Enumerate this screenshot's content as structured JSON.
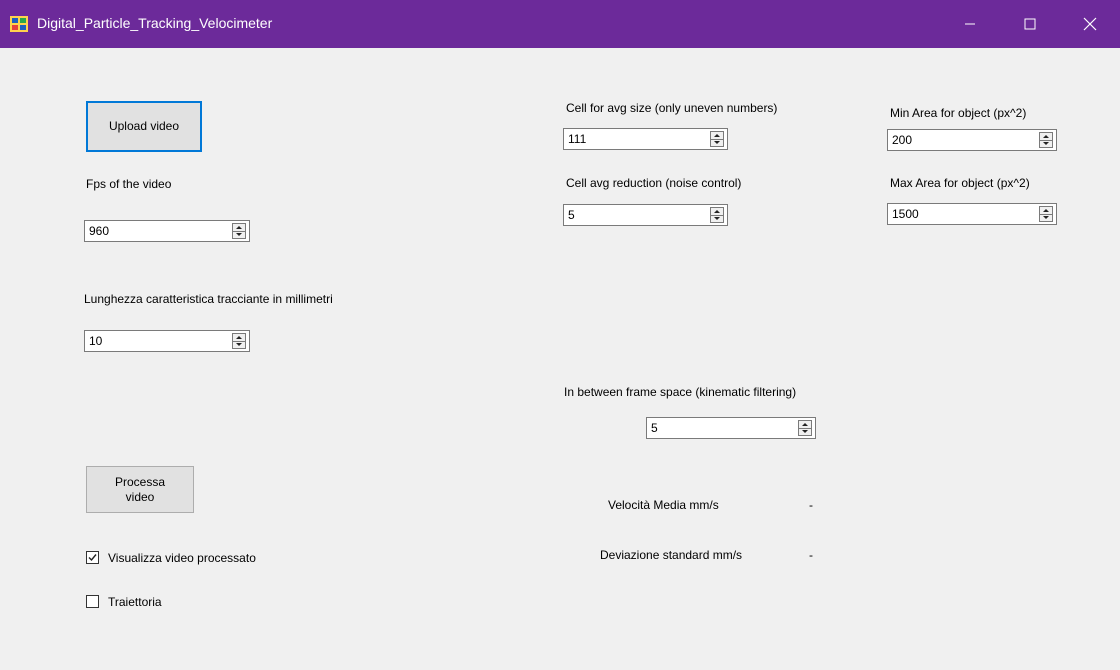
{
  "window": {
    "title": "Digital_Particle_Tracking_Velocimeter",
    "minimize_glyph": "—",
    "maximize_glyph": "☐",
    "close_glyph": "✕"
  },
  "upload_button": {
    "label": "Upload video"
  },
  "fps": {
    "label": "Fps of the video",
    "value": "960"
  },
  "length": {
    "label": "Lunghezza caratteristica tracciante in millimetri",
    "value": "10"
  },
  "process_button": {
    "line1": "Processa",
    "line2": "video"
  },
  "show_processed": {
    "label": "Visualizza video processato",
    "checked": true,
    "check_glyph": "✓"
  },
  "trajectory": {
    "label": "Traiettoria",
    "checked": false
  },
  "cell_avg_size": {
    "label": "Cell for avg size (only uneven numbers)",
    "value": "111"
  },
  "cell_avg_reduction": {
    "label": "Cell  avg reduction (noise control)",
    "value": "5"
  },
  "min_area": {
    "label": "Min Area for object (px^2)",
    "value": "200"
  },
  "max_area": {
    "label": "Max Area for object (px^2)",
    "value": "1500"
  },
  "frame_space": {
    "label": "In between frame space (kinematic filtering)",
    "value": "5"
  },
  "velocity": {
    "label": "Velocità Media mm/s",
    "value": "-"
  },
  "std_dev": {
    "label": "Deviazione standard mm/s",
    "value": "-"
  },
  "colors": {
    "titlebar": "#6c2a9a",
    "focus": "#0078d7"
  },
  "icons": [
    "app-icon",
    "minimize-icon",
    "maximize-icon",
    "close-icon",
    "spin-up-icon",
    "spin-down-icon",
    "checkmark-icon"
  ]
}
